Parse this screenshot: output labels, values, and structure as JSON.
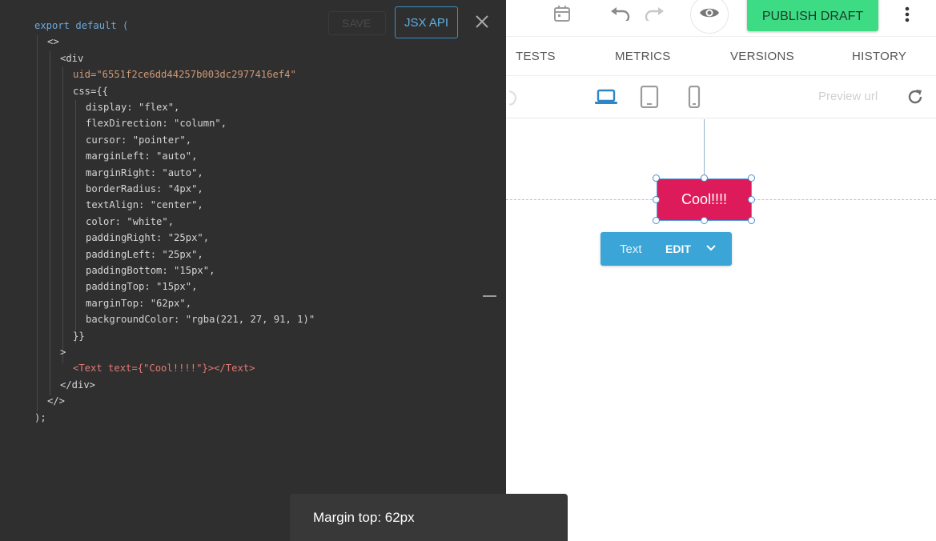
{
  "topbar": {
    "publish_label": "PUBLISH DRAFT"
  },
  "tabs": [
    "TESTS",
    "METRICS",
    "VERSIONS",
    "HISTORY"
  ],
  "devices": {
    "preview_placeholder": "Preview url"
  },
  "canvas": {
    "button_text": "Cool!!!!",
    "textbar": {
      "type_label": "Text",
      "edit_label": "EDIT"
    }
  },
  "code_panel": {
    "ghost_save_label": "SAVE",
    "jsx_api_label": "JSX API",
    "lines": [
      "export default (",
      "<>",
      "<div",
      "uid=\"6551f2ce6dd44257b003dc2977416ef4\"",
      "css={{",
      "display: \"flex\",",
      "flexDirection: \"column\",",
      "cursor: \"pointer\",",
      "marginLeft: \"auto\",",
      "marginRight: \"auto\",",
      "borderRadius: \"4px\",",
      "textAlign: \"center\",",
      "color: \"white\",",
      "paddingRight: \"25px\",",
      "paddingLeft: \"25px\",",
      "paddingBottom: \"15px\",",
      "paddingTop: \"15px\",",
      "marginTop: \"62px\",",
      "backgroundColor: \"rgba(221, 27, 91, 1)\"",
      "}}",
      ">",
      "<Text text={\"Cool!!!!\"}></Text>",
      "</div>",
      "</>",
      ");"
    ]
  },
  "toast": {
    "message": "Margin top: 62px"
  },
  "colors": {
    "accent_green": "#3ddc84",
    "selected_element_bg": "#dd1b5b",
    "toolbar_blue": "#3aa5d6",
    "code_bg": "#2f2f30"
  }
}
